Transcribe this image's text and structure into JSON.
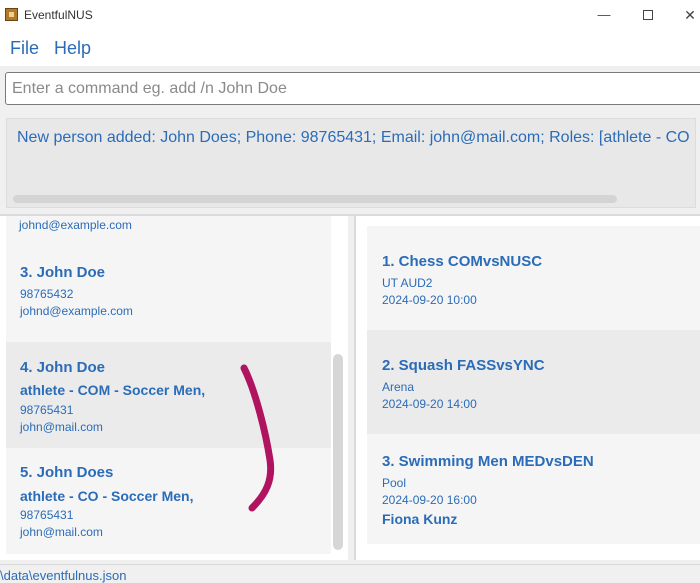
{
  "window": {
    "title": "EventfulNUS"
  },
  "menu": {
    "file": "File",
    "help": "Help"
  },
  "command": {
    "placeholder": "Enter a command eg. add /n John Doe",
    "value": ""
  },
  "result": {
    "text": "New person added: John Does; Phone: 98765431; Email: john@mail.com; Roles: [athlete - CO"
  },
  "persons": {
    "clipped_email": "johnd@example.com",
    "items": [
      {
        "name": "3. John Doe",
        "role": "",
        "phone": "98765432",
        "email": "johnd@example.com"
      },
      {
        "name": "4. John Doe",
        "role": "athlete - COM - Soccer Men,",
        "phone": "98765431",
        "email": "john@mail.com"
      },
      {
        "name": "5. John Does",
        "role": "athlete - CO - Soccer Men,",
        "phone": "98765431",
        "email": "john@mail.com"
      }
    ]
  },
  "events": {
    "items": [
      {
        "name": "1. Chess COMvsNUSC",
        "venue": "UT AUD2",
        "time": "2024-09-20 10:00",
        "extra": ""
      },
      {
        "name": "2. Squash FASSvsYNC",
        "venue": "Arena",
        "time": "2024-09-20 14:00",
        "extra": ""
      },
      {
        "name": "3. Swimming Men MEDvsDEN",
        "venue": "Pool",
        "time": "2024-09-20 16:00",
        "extra": "Fiona Kunz"
      }
    ]
  },
  "status": {
    "path": "\\data\\eventfulnus.json"
  },
  "colors": {
    "accent": "#2b6cb8",
    "annotation": "#b0135f"
  }
}
